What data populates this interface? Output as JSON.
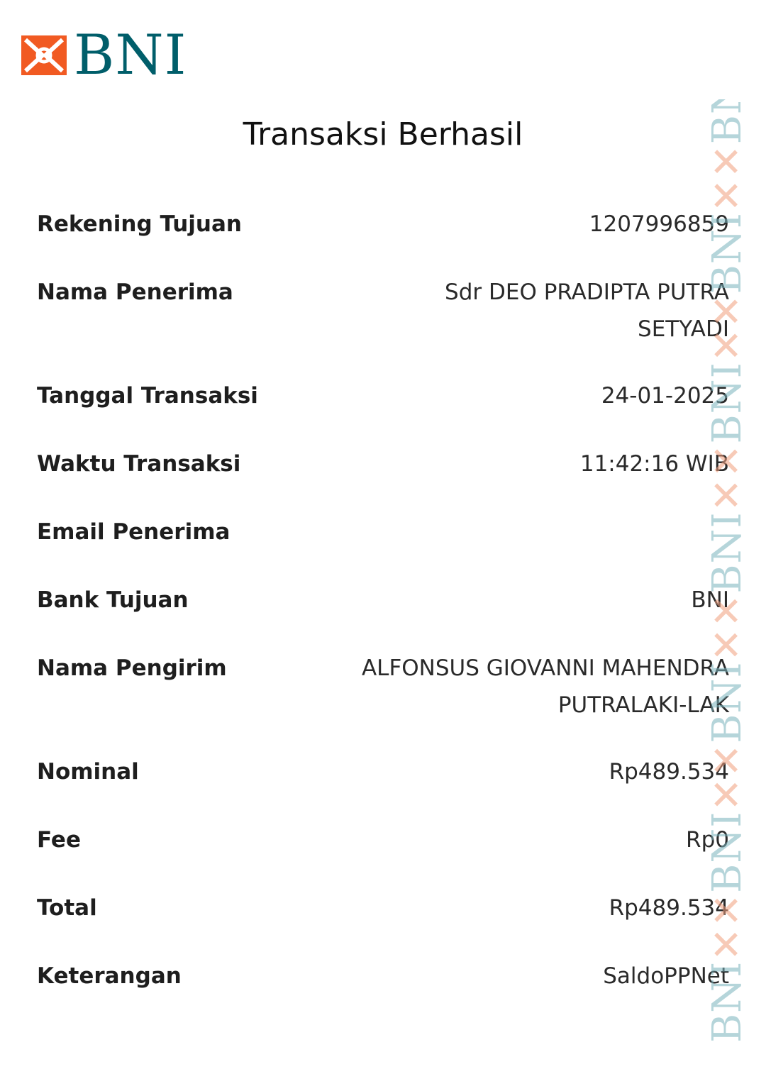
{
  "brand": {
    "name": "BNI",
    "primary_color": "#005e6a",
    "accent_color": "#f15a22"
  },
  "title": "Transaksi Berhasil",
  "details": [
    {
      "label": "Rekening Tujuan",
      "value": "1207996859"
    },
    {
      "label": "Nama Penerima",
      "value": "Sdr DEO PRADIPTA PUTRA SETYADI"
    },
    {
      "label": "Tanggal Transaksi",
      "value": "24-01-2025"
    },
    {
      "label": "Waktu Transaksi",
      "value": "11:42:16 WIB"
    },
    {
      "label": "Email Penerima",
      "value": ""
    },
    {
      "label": "Bank Tujuan",
      "value": "BNI"
    },
    {
      "label": "Nama Pengirim",
      "value": "ALFONSUS GIOVANNI MAHENDRA PUTRALAKI-LAK"
    },
    {
      "label": "Nominal",
      "value": "Rp489.534"
    },
    {
      "label": "Fee",
      "value": "Rp0"
    },
    {
      "label": "Total",
      "value": "Rp489.534"
    },
    {
      "label": "Keterangan",
      "value": "SaldoPPNet"
    }
  ],
  "watermark": {
    "text": "BNI"
  }
}
